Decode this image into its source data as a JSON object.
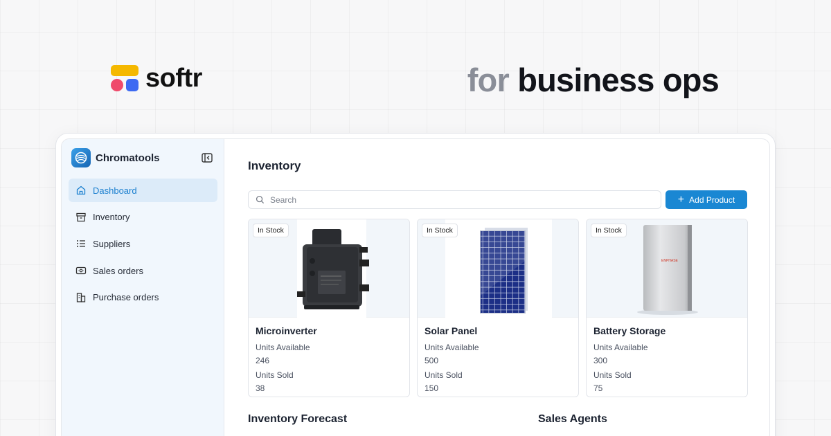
{
  "promo": {
    "brand_name": "softr",
    "tagline_prefix": "for",
    "tagline_main": "business ops",
    "colors": {
      "logo_yellow": "#f5b800",
      "logo_pink": "#ef4a6b",
      "logo_blue": "#3d6af2"
    }
  },
  "app": {
    "name": "Chromatools",
    "accent": "#1a87d3"
  },
  "sidebar": {
    "items": [
      {
        "label": "Dashboard",
        "icon": "home-icon",
        "active": true
      },
      {
        "label": "Inventory",
        "icon": "archive-icon",
        "active": false
      },
      {
        "label": "Suppliers",
        "icon": "list-icon",
        "active": false
      },
      {
        "label": "Sales orders",
        "icon": "receipt-icon",
        "active": false
      },
      {
        "label": "Purchase orders",
        "icon": "buildings-icon",
        "active": false
      }
    ]
  },
  "main": {
    "title": "Inventory",
    "search_placeholder": "Search",
    "add_button": "Add Product",
    "products": [
      {
        "badge": "In Stock",
        "name": "Microinverter",
        "units_available_label": "Units Available",
        "units_available": "246",
        "units_sold_label": "Units Sold",
        "units_sold": "38",
        "image": "microinverter-image"
      },
      {
        "badge": "In Stock",
        "name": "Solar Panel",
        "units_available_label": "Units Available",
        "units_available": "500",
        "units_sold_label": "Units Sold",
        "units_sold": "150",
        "image": "solar-panel-image"
      },
      {
        "badge": "In Stock",
        "name": "Battery Storage",
        "units_available_label": "Units Available",
        "units_available": "300",
        "units_sold_label": "Units Sold",
        "units_sold": "75",
        "image": "battery-image",
        "image_brand": "ENPHASE"
      }
    ],
    "sections": [
      "Inventory Forecast",
      "Sales Agents"
    ]
  }
}
